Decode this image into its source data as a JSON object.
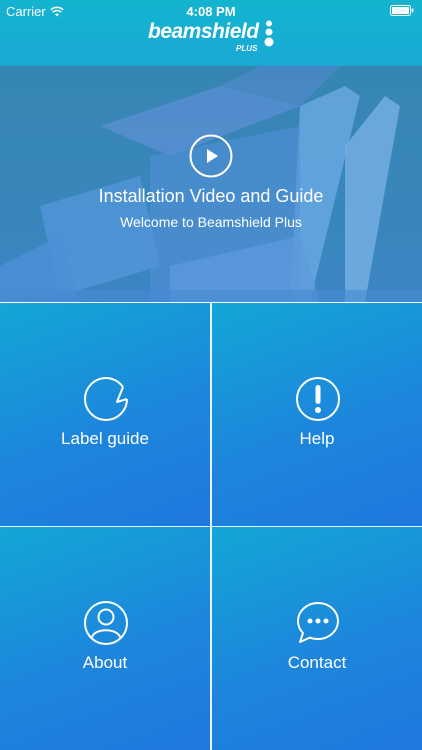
{
  "status_bar": {
    "carrier": "Carrier",
    "time": "4:08 PM"
  },
  "header": {
    "logo_text": "beamshield",
    "logo_sub": "PLUS"
  },
  "hero": {
    "title": "Installation Video and Guide",
    "subtitle": "Welcome to Beamshield Plus"
  },
  "tiles": [
    {
      "label": "Label guide",
      "icon": "label-sticker-icon"
    },
    {
      "label": "Help",
      "icon": "exclamation-icon"
    },
    {
      "label": "About",
      "icon": "user-icon"
    },
    {
      "label": "Contact",
      "icon": "chat-bubble-icon"
    }
  ],
  "colors": {
    "header": "#13b4cf",
    "tile": "#1d86dc"
  }
}
